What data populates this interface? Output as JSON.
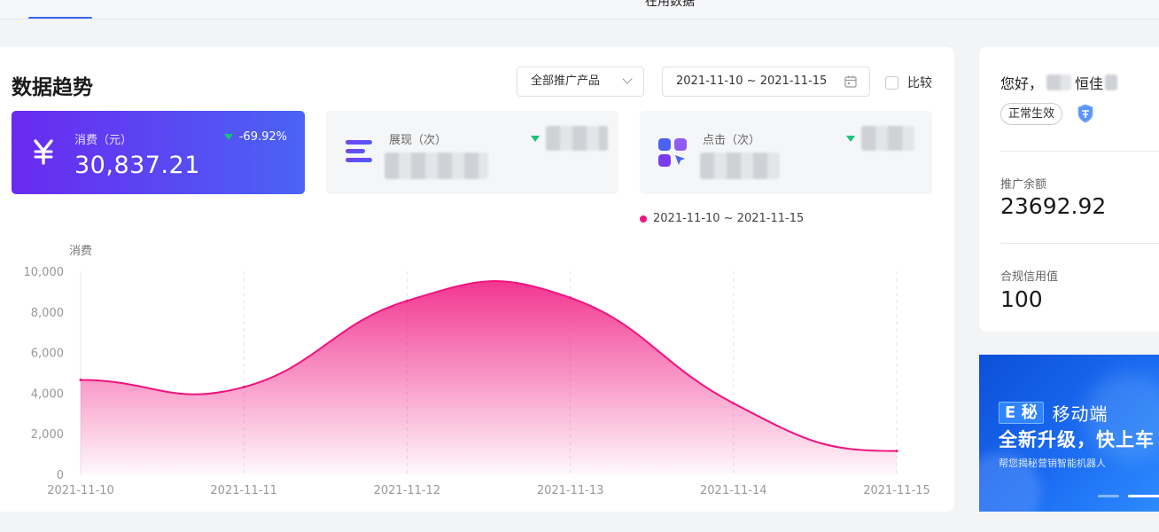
{
  "topbar": {
    "cut_text": "在用数据"
  },
  "section": {
    "title": "数据趋势"
  },
  "filters": {
    "product_select": "全部推广产品",
    "date_range": "2021-11-10 ~ 2021-11-15",
    "compare_label": "比较"
  },
  "metrics": [
    {
      "label": "消费（元）",
      "value": "30,837.21",
      "change": "-69.92%",
      "icon": "yen-icon"
    },
    {
      "label": "展现（次）",
      "icon": "list-lines-icon"
    },
    {
      "label": "点击（次）",
      "icon": "click-grid-icon"
    }
  ],
  "legend": {
    "label": "2021-11-10 ~ 2021-11-15"
  },
  "chart_data": {
    "type": "area",
    "ylabel": "消费",
    "x": [
      "2021-11-10",
      "2021-11-11",
      "2021-11-12",
      "2021-11-13",
      "2021-11-14",
      "2021-11-15"
    ],
    "series": [
      {
        "name": "2021-11-10 ~ 2021-11-15",
        "values": [
          4650,
          4300,
          8550,
          8700,
          3500,
          1150
        ]
      }
    ],
    "ylim": [
      0,
      10000
    ],
    "yticks": [
      "0",
      "2,000",
      "4,000",
      "6,000",
      "8,000",
      "10,000"
    ],
    "grid": "vertical-dashed",
    "color": "#f0137e"
  },
  "account": {
    "greeting": "您好，",
    "name": "恒佳",
    "status": "正常生效",
    "balance_label": "推广余额",
    "balance_value": "23692.92",
    "credit_label": "合规信用值",
    "credit_value": "100"
  },
  "banner": {
    "brand": "E 秘",
    "subtitle": "移动端",
    "title": "全新升级，快上车",
    "desc": "帮您揭秘营销智能机器人"
  },
  "colors": {
    "accent": "#f0137e",
    "primary": "#4a63f5",
    "up_down": "#18c27a"
  }
}
